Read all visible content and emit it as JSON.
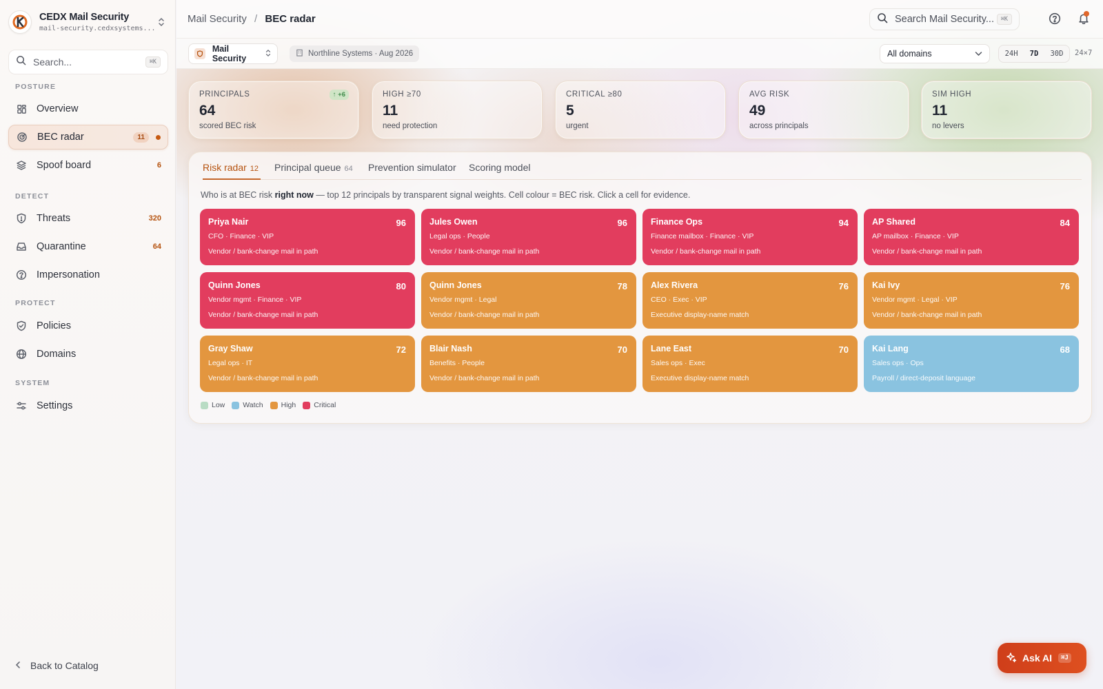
{
  "brand": {
    "name": "CEDX Mail Security",
    "subtitle": "mail-security.cedxsystems..."
  },
  "sidebar": {
    "search_placeholder": "Search...",
    "search_kbd": "⌘K",
    "sections": {
      "posture": "POSTURE",
      "detect": "DETECT",
      "protect": "PROTECT",
      "system": "SYSTEM"
    },
    "items": [
      {
        "label": "Overview",
        "icon": "grid-icon"
      },
      {
        "label": "BEC radar",
        "icon": "radar-icon",
        "count": "11"
      },
      {
        "label": "Spoof board",
        "icon": "layers-icon",
        "count": "6"
      },
      {
        "label": "Threats",
        "icon": "shield-icon",
        "count": "320"
      },
      {
        "label": "Quarantine",
        "icon": "inbox-icon",
        "count": "64"
      },
      {
        "label": "Impersonation",
        "icon": "help-circle-icon"
      },
      {
        "label": "Policies",
        "icon": "shield-check-icon"
      },
      {
        "label": "Domains",
        "icon": "globe-icon"
      },
      {
        "label": "Settings",
        "icon": "sliders-icon"
      }
    ],
    "back_label": "Back to Catalog"
  },
  "header": {
    "breadcrumb_parent": "Mail Security",
    "breadcrumb_sep": "/",
    "breadcrumb_current": "BEC radar",
    "search_placeholder": "Search Mail Security...",
    "search_kbd": "⌘K"
  },
  "subbar": {
    "product": "Mail Security",
    "org": "Northline Systems · Aug 2026",
    "domain_select": "All domains",
    "ranges": [
      "24H",
      "7D",
      "30D"
    ],
    "active_range": "7D",
    "extra_range": "24×7"
  },
  "kpis": [
    {
      "label": "PRINCIPALS",
      "value": "64",
      "sub": "scored BEC risk",
      "delta": "↑ +6"
    },
    {
      "label": "HIGH ≥70",
      "value": "11",
      "sub": "need protection"
    },
    {
      "label": "CRITICAL ≥80",
      "value": "5",
      "sub": "urgent"
    },
    {
      "label": "AVG RISK",
      "value": "49",
      "sub": "across principals"
    },
    {
      "label": "SIM HIGH",
      "value": "11",
      "sub": "no levers"
    }
  ],
  "tabs": [
    {
      "label": "Risk radar",
      "count": "12"
    },
    {
      "label": "Principal queue",
      "count": "64"
    },
    {
      "label": "Prevention simulator"
    },
    {
      "label": "Scoring model"
    }
  ],
  "desc": {
    "pre": "Who is at BEC risk ",
    "bold": "right now",
    "post": " — top 12 principals by transparent signal weights. Cell colour = BEC risk. Click a cell for evidence."
  },
  "principals": [
    {
      "name": "Priya Nair",
      "score": "96",
      "role": "CFO · Finance · VIP",
      "signal": "Vendor / bank-change mail in path",
      "level": "critical"
    },
    {
      "name": "Jules Owen",
      "score": "96",
      "role": "Legal ops · People",
      "signal": "Vendor / bank-change mail in path",
      "level": "critical"
    },
    {
      "name": "Finance Ops",
      "score": "94",
      "role": "Finance mailbox · Finance · VIP",
      "signal": "Vendor / bank-change mail in path",
      "level": "critical"
    },
    {
      "name": "AP Shared",
      "score": "84",
      "role": "AP mailbox · Finance · VIP",
      "signal": "Vendor / bank-change mail in path",
      "level": "critical"
    },
    {
      "name": "Quinn Jones",
      "score": "80",
      "role": "Vendor mgmt · Finance · VIP",
      "signal": "Vendor / bank-change mail in path",
      "level": "critical"
    },
    {
      "name": "Quinn Jones",
      "score": "78",
      "role": "Vendor mgmt · Legal",
      "signal": "Vendor / bank-change mail in path",
      "level": "high"
    },
    {
      "name": "Alex Rivera",
      "score": "76",
      "role": "CEO · Exec · VIP",
      "signal": "Executive display-name match",
      "level": "high"
    },
    {
      "name": "Kai Ivy",
      "score": "76",
      "role": "Vendor mgmt · Legal · VIP",
      "signal": "Vendor / bank-change mail in path",
      "level": "high"
    },
    {
      "name": "Gray Shaw",
      "score": "72",
      "role": "Legal ops · IT",
      "signal": "Vendor / bank-change mail in path",
      "level": "high"
    },
    {
      "name": "Blair Nash",
      "score": "70",
      "role": "Benefits · People",
      "signal": "Vendor / bank-change mail in path",
      "level": "high"
    },
    {
      "name": "Lane East",
      "score": "70",
      "role": "Sales ops · Exec",
      "signal": "Executive display-name match",
      "level": "high"
    },
    {
      "name": "Kai Lang",
      "score": "68",
      "role": "Sales ops · Ops",
      "signal": "Payroll / direct-deposit language",
      "level": "watch"
    }
  ],
  "legend": [
    {
      "label": "Low",
      "color": "#b9dcc4"
    },
    {
      "label": "Watch",
      "color": "#8ac3e0"
    },
    {
      "label": "High",
      "color": "#e3963f"
    },
    {
      "label": "Critical",
      "color": "#e23d5e"
    }
  ],
  "level_colors": {
    "critical": "#e23d5e",
    "high": "#e3963f",
    "watch": "#8ac3e0",
    "low": "#b9dcc4"
  },
  "ask_ai": {
    "label": "Ask AI",
    "kbd": "⌘J"
  }
}
